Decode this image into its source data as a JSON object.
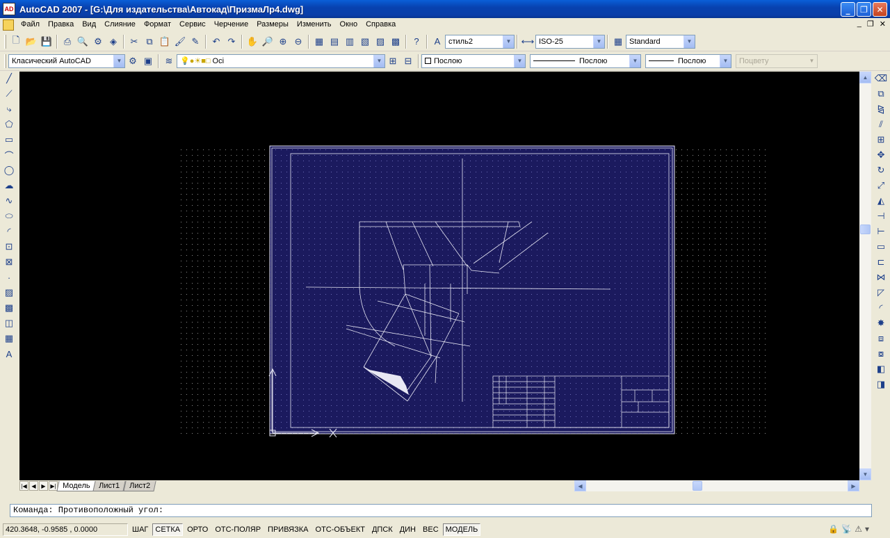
{
  "window": {
    "title": "AutoCAD 2007 - [G:\\Для издательства\\Автокад\\ПризмаЛр4.dwg]",
    "app_icon": "AD"
  },
  "menu": [
    "Файл",
    "Правка",
    "Вид",
    "Слияние",
    "Формат",
    "Сервис",
    "Черчение",
    "Размеры",
    "Изменить",
    "Окно",
    "Справка"
  ],
  "toolbar1": {
    "text_style": "стиль2",
    "dim_style": "ISO-25",
    "table_style": "Standard"
  },
  "toolbar2": {
    "workspace": "Класический AutoCAD",
    "layer": "Oci",
    "color": "Послою",
    "linetype": "Послою",
    "lineweight": "Послою",
    "plotstyle": "Поцвету"
  },
  "tabs": [
    {
      "label": "Модель",
      "active": true
    },
    {
      "label": "Лист1",
      "active": false
    },
    {
      "label": "Лист2",
      "active": false
    }
  ],
  "command": {
    "text": "Команда: Противоположный угол:"
  },
  "status": {
    "coords": "420.3648, -0.9585 , 0.0000",
    "modes": [
      {
        "label": "ШАГ",
        "on": false
      },
      {
        "label": "СЕТКА",
        "on": true
      },
      {
        "label": "ОРТО",
        "on": false
      },
      {
        "label": "ОТС-ПОЛЯР",
        "on": false
      },
      {
        "label": "ПРИВЯЗКА",
        "on": false
      },
      {
        "label": "ОТС-ОБЪЕКТ",
        "on": false
      },
      {
        "label": "ДПСК",
        "on": false
      },
      {
        "label": "ДИН",
        "on": false
      },
      {
        "label": "ВЕС",
        "on": false
      },
      {
        "label": "МОДЕЛЬ",
        "on": true
      }
    ]
  },
  "colors": {
    "canvas": "#000000",
    "sheet": "#1b1a5e",
    "lines": "#e8e8f4",
    "title_bar": "#0a5fd8"
  }
}
